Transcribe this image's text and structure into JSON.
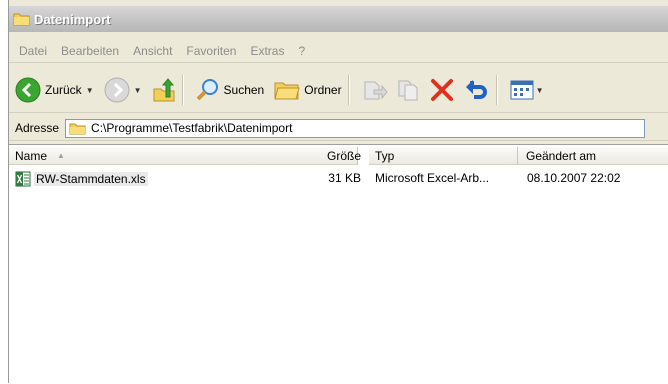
{
  "window": {
    "title": "Datenimport"
  },
  "menu": [
    "Datei",
    "Bearbeiten",
    "Ansicht",
    "Favoriten",
    "Extras",
    "?"
  ],
  "toolbar": {
    "back_label": "Zurück",
    "search_label": "Suchen",
    "folders_label": "Ordner",
    "icons": [
      "back-icon",
      "forward-icon",
      "up-folder-icon",
      "search-icon",
      "folders-icon",
      "move-to-icon",
      "copy-to-icon",
      "delete-icon",
      "undo-icon",
      "views-icon"
    ]
  },
  "address": {
    "label": "Adresse",
    "path": "C:\\Programme\\Testfabrik\\Datenimport"
  },
  "columns": {
    "name": "Name",
    "size": "Größe",
    "type": "Typ",
    "modified": "Geändert am"
  },
  "files": [
    {
      "name": "RW-Stammdaten.xls",
      "size": "31 KB",
      "type": "Microsoft Excel-Arb...",
      "modified": "08.10.2007 22:02"
    }
  ],
  "colors": {
    "back_green": "#3aa52f",
    "delete_red": "#e0301e",
    "undo_blue": "#1f63c8",
    "folder_yellow": "#f3cf5a"
  }
}
